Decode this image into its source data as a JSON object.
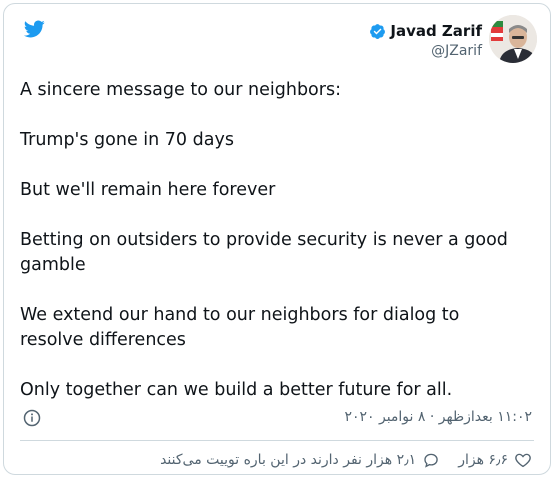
{
  "author": {
    "name": "Javad Zarif",
    "handle": "@JZarif"
  },
  "tweet": {
    "paragraphs": [
      "A sincere message to our neighbors:",
      "Trump's gone in 70 days",
      "But we'll remain here forever",
      "Betting on outsiders to provide security is never a good gamble",
      "We extend our hand to our neighbors for dialog to resolve differences",
      "Only together can we build a better future for all."
    ]
  },
  "meta": {
    "timestamp": "۱۱:۰۲ بعدازظهر · ۸ نوامبر ۲۰۲۰"
  },
  "actions": {
    "likes": "۶٫۶ هزار",
    "replies_label": "۲٫۱ هزار نفر دارند در این باره توییت می‌کنند"
  },
  "colors": {
    "brand": "#1d9bf0",
    "text": "#0f1419",
    "secondary": "#536471",
    "border": "#cfd9de"
  },
  "icons": {
    "logo": "twitter-bird-icon",
    "verified": "verified-badge-icon",
    "info": "info-icon",
    "like": "heart-icon",
    "reply": "reply-bubble-icon"
  }
}
